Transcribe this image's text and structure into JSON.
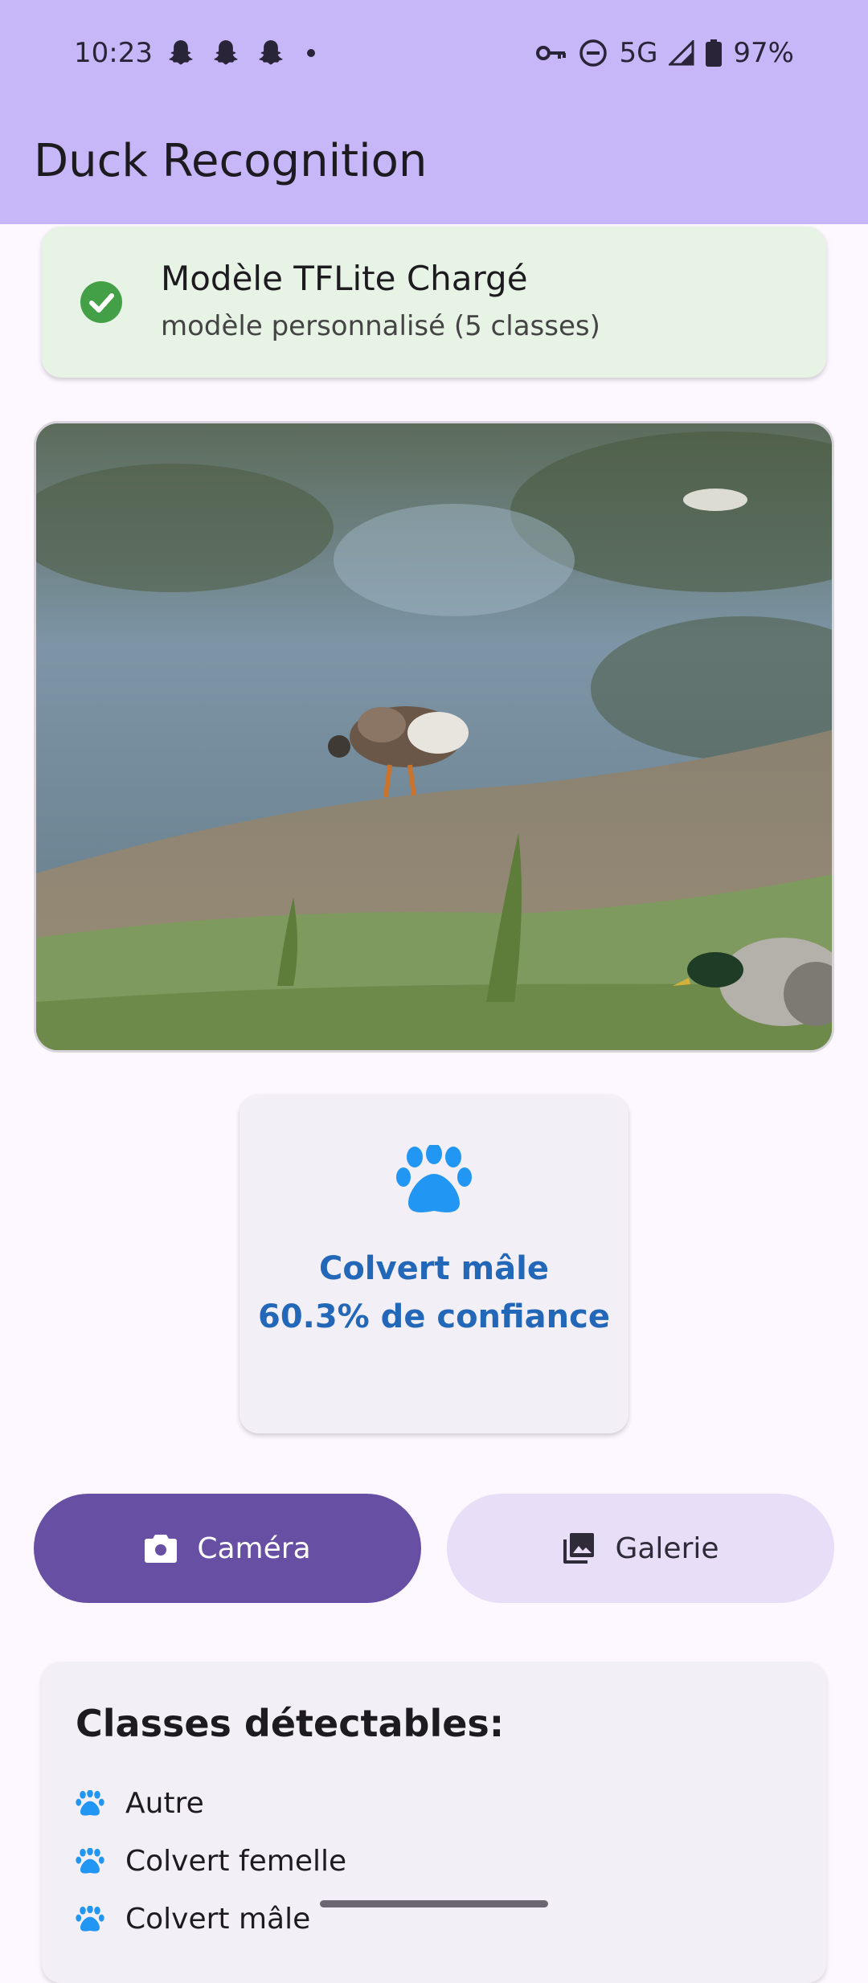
{
  "status_bar": {
    "time": "10:23",
    "network": "5G",
    "battery": "97%",
    "left_icons": [
      "snapchat-icon",
      "snapchat-icon",
      "snapchat-icon",
      "notification-dot"
    ],
    "right_icons": [
      "vpn-key-icon",
      "do-not-disturb-icon",
      "signal-icon",
      "battery-icon"
    ]
  },
  "app_bar": {
    "title": "Duck Recognition",
    "color": "#c7b7f8"
  },
  "model_status": {
    "icon": "check-circle-icon",
    "title": "Modèle TFLite Chargé",
    "subtitle": "modèle personnalisé (5 classes)",
    "color": "#e6f3e5",
    "icon_color": "#43a047"
  },
  "result": {
    "icon": "paw-icon",
    "label": "Colvert mâle",
    "confidence_text": "60.3% de confiance",
    "confidence": 60.3,
    "color": "#2368b8"
  },
  "actions": {
    "camera_label": "Caméra",
    "gallery_label": "Galerie",
    "primary_color": "#6750a4",
    "secondary_color": "#e8def8"
  },
  "classes": {
    "title": "Classes détectables:",
    "items": [
      "Autre",
      "Colvert femelle",
      "Colvert mâle"
    ]
  }
}
